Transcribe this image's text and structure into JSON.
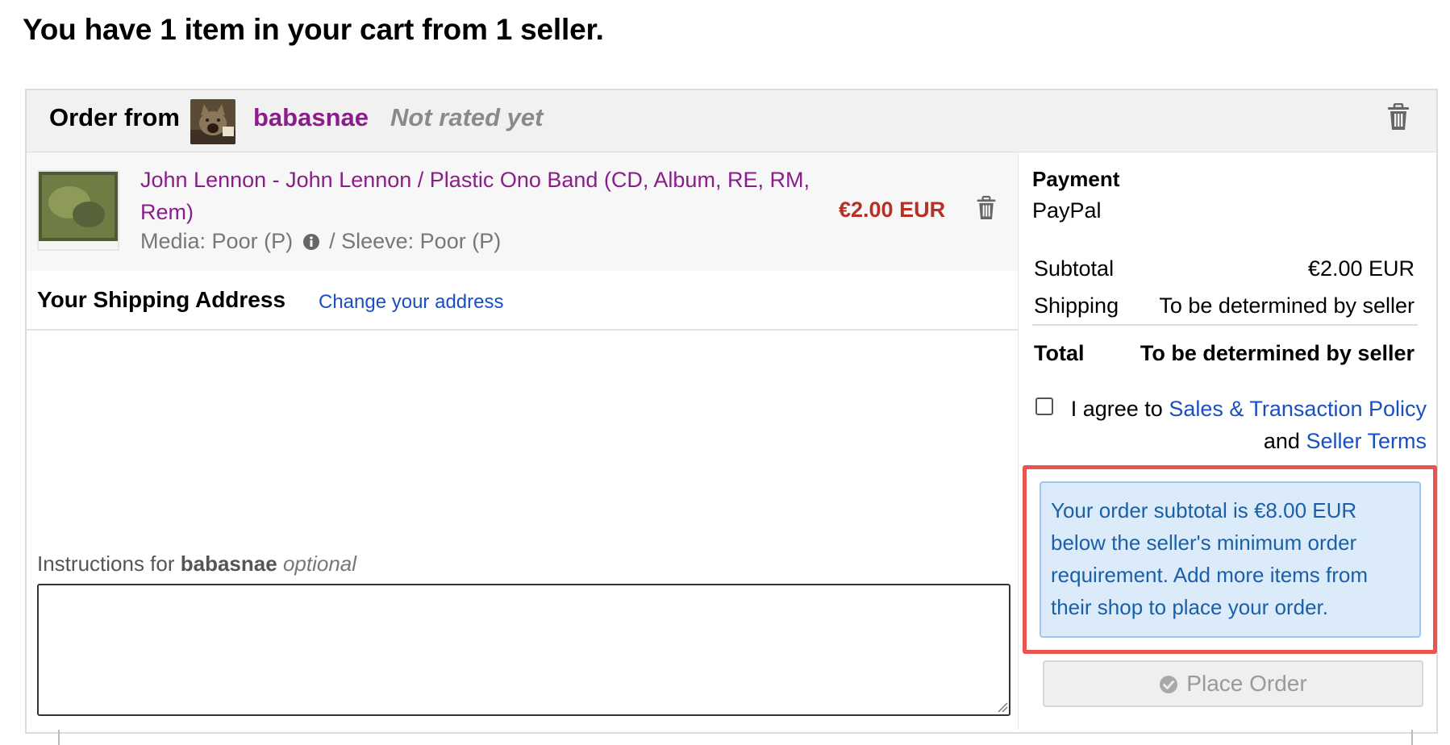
{
  "page": {
    "heading": "You have 1 item in your cart from 1 seller."
  },
  "order": {
    "order_from_label": "Order from",
    "seller_name": "babasnae",
    "rating_text": "Not rated yet",
    "avatar_icon": "seller-avatar-cat",
    "remove_order_icon": "trash-icon"
  },
  "item": {
    "title": "John Lennon - John Lennon / Plastic Ono Band (CD, Album, RE, RM, Rem)",
    "condition_media": "Media: Poor (P)",
    "condition_sleeve": "/ Sleeve: Poor (P)",
    "price": "€2.00 EUR",
    "remove_icon": "trash-icon",
    "info_icon": "info-icon"
  },
  "shipping": {
    "title": "Your Shipping Address",
    "change_link": "Change your address"
  },
  "instructions": {
    "label_prefix": "Instructions for",
    "seller": "babasnae",
    "optional": "optional",
    "value": ""
  },
  "payment": {
    "label": "Payment",
    "method": "PayPal"
  },
  "totals": {
    "subtotal_label": "Subtotal",
    "subtotal_value": "€2.00 EUR",
    "shipping_label": "Shipping",
    "shipping_value": "To be determined by seller",
    "total_label": "Total",
    "total_value": "To be determined by seller"
  },
  "agreement": {
    "checked": false,
    "prefix": "I agree to",
    "policy_link": "Sales & Transaction Policy",
    "and": "and",
    "terms_link": "Seller Terms"
  },
  "notice": {
    "text": "Your order subtotal is €8.00 EUR below the seller's minimum order requirement. Add more items from their shop to place your order."
  },
  "place_order": {
    "label": "Place Order",
    "icon": "check-circle-icon",
    "disabled": true
  },
  "colors": {
    "seller_purple": "#8b1d8b",
    "price_red": "#b83024",
    "link_blue": "#1a4fbf",
    "notice_bg": "#dcebfa",
    "highlight_red": "#e8554e"
  }
}
